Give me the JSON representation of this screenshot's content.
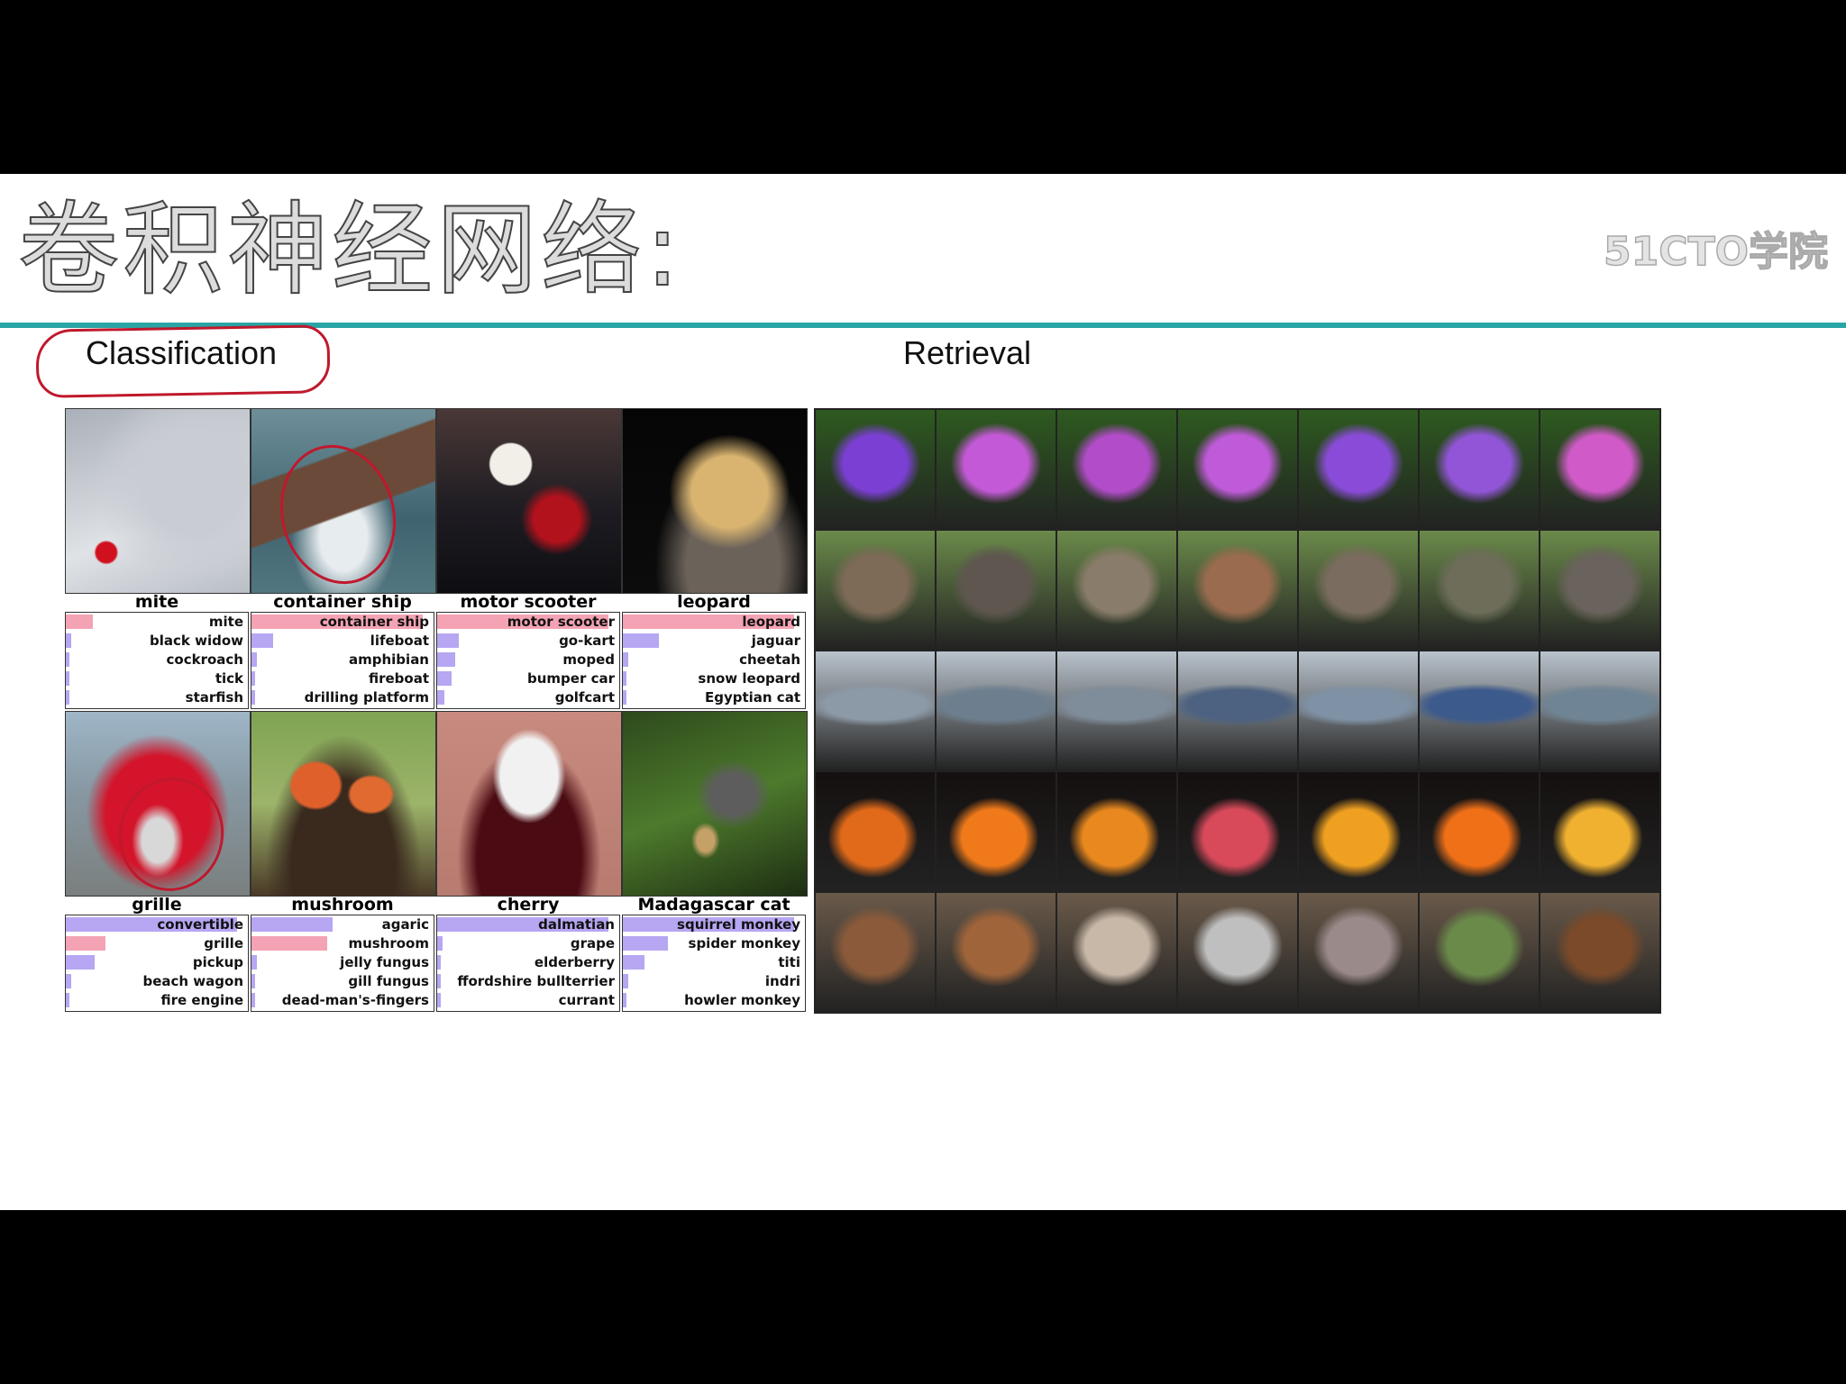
{
  "slide": {
    "title": "卷积神经网络:",
    "watermark": "51CTO学院",
    "classification_label": "Classification",
    "retrieval_label": "Retrieval"
  },
  "classification": [
    {
      "caption": "mite",
      "preds": [
        {
          "label": "mite",
          "score": 0.15,
          "correct": true
        },
        {
          "label": "black widow",
          "score": 0.03
        },
        {
          "label": "cockroach",
          "score": 0.02
        },
        {
          "label": "tick",
          "score": 0.015
        },
        {
          "label": "starfish",
          "score": 0.01
        }
      ],
      "photo": "mite"
    },
    {
      "caption": "container ship",
      "preds": [
        {
          "label": "container ship",
          "score": 0.95,
          "correct": true
        },
        {
          "label": "lifeboat",
          "score": 0.12
        },
        {
          "label": "amphibian",
          "score": 0.03
        },
        {
          "label": "fireboat",
          "score": 0.02
        },
        {
          "label": "drilling platform",
          "score": 0.015
        }
      ],
      "photo": "ship"
    },
    {
      "caption": "motor scooter",
      "preds": [
        {
          "label": "motor scooter",
          "score": 0.95,
          "correct": true
        },
        {
          "label": "go-kart",
          "score": 0.12
        },
        {
          "label": "moped",
          "score": 0.1
        },
        {
          "label": "bumper car",
          "score": 0.08
        },
        {
          "label": "golfcart",
          "score": 0.04
        }
      ],
      "photo": "scooter"
    },
    {
      "caption": "leopard",
      "preds": [
        {
          "label": "leopard",
          "score": 0.95,
          "correct": true
        },
        {
          "label": "jaguar",
          "score": 0.2
        },
        {
          "label": "cheetah",
          "score": 0.03
        },
        {
          "label": "snow leopard",
          "score": 0.02
        },
        {
          "label": "Egyptian cat",
          "score": 0.01
        }
      ],
      "photo": "leopard"
    },
    {
      "caption": "grille",
      "preds": [
        {
          "label": "convertible",
          "score": 0.95
        },
        {
          "label": "grille",
          "score": 0.22,
          "correct": true
        },
        {
          "label": "pickup",
          "score": 0.16
        },
        {
          "label": "beach wagon",
          "score": 0.03
        },
        {
          "label": "fire engine",
          "score": 0.02
        }
      ],
      "photo": "grille"
    },
    {
      "caption": "mushroom",
      "preds": [
        {
          "label": "agaric",
          "score": 0.45
        },
        {
          "label": "mushroom",
          "score": 0.42,
          "correct": true
        },
        {
          "label": "jelly fungus",
          "score": 0.03
        },
        {
          "label": "gill fungus",
          "score": 0.02
        },
        {
          "label": "dead-man's-fingers",
          "score": 0.01
        }
      ],
      "photo": "mushroom"
    },
    {
      "caption": "cherry",
      "preds": [
        {
          "label": "dalmatian",
          "score": 0.95
        },
        {
          "label": "grape",
          "score": 0.03
        },
        {
          "label": "elderberry",
          "score": 0.02
        },
        {
          "label": "ffordshire bullterrier",
          "score": 0.015
        },
        {
          "label": "currant",
          "score": 0.01
        }
      ],
      "photo": "dalmatian"
    },
    {
      "caption": "Madagascar cat",
      "preds": [
        {
          "label": "squirrel monkey",
          "score": 0.95
        },
        {
          "label": "spider monkey",
          "score": 0.25
        },
        {
          "label": "titi",
          "score": 0.12
        },
        {
          "label": "indri",
          "score": 0.03
        },
        {
          "label": "howler monkey",
          "score": 0.02
        }
      ],
      "photo": "lemur"
    }
  ],
  "colors": {
    "correct_bar": "#f4a3b4",
    "other_bar": "#b7a6f2",
    "accent_rule": "#2aa5a5",
    "pen": "#c0182c"
  },
  "retrieval_rows": [
    "flower",
    "elephant",
    "carrier",
    "pumpkin",
    "dog"
  ]
}
